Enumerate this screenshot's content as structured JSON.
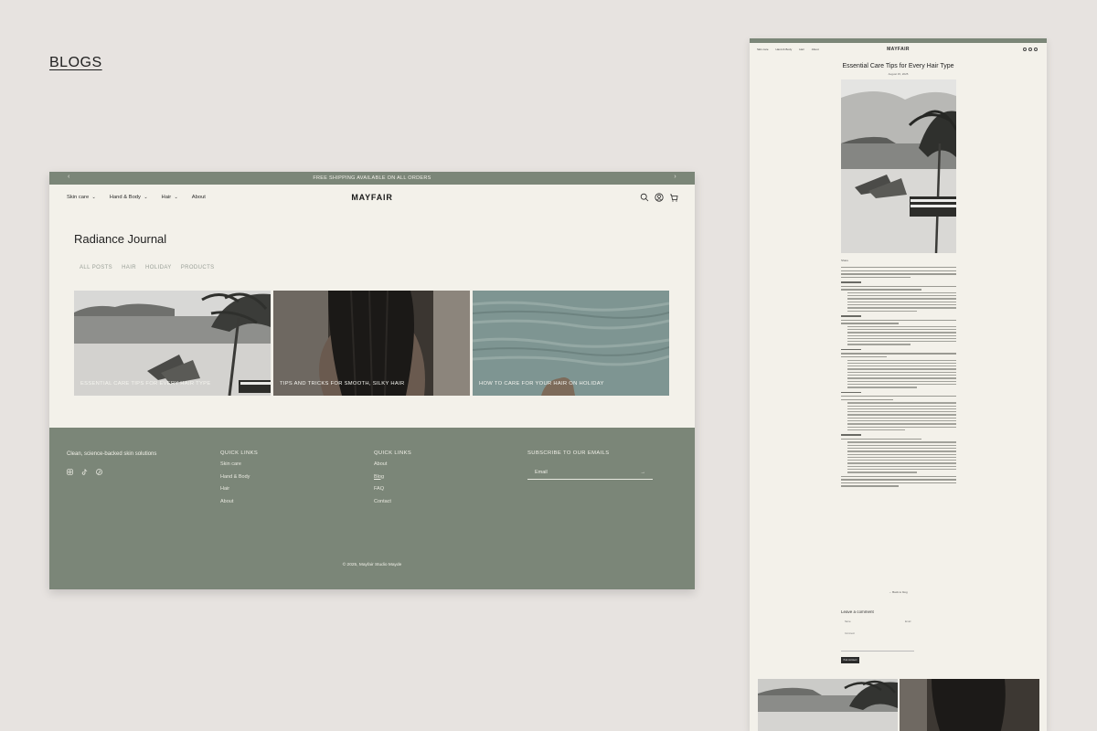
{
  "page": {
    "heading": "BLOGS"
  },
  "desktop": {
    "announcement": "FREE SHIPPING AVAILABLE ON ALL ORDERS",
    "nav": {
      "items": [
        "Skin care",
        "Hand & Body",
        "Hair",
        "About"
      ]
    },
    "logo": "MAYFAIR",
    "journal_title": "Radiance Journal",
    "filters": [
      "ALL POSTS",
      "HAIR",
      "HOLIDAY",
      "PRODUCTS"
    ],
    "cards": [
      {
        "label": "ESSENTIAL CARE TIPS FOR EVERY HAIR TYPE"
      },
      {
        "label": "TIPS AND TRICKS FOR SMOOTH, SILKY HAIR"
      },
      {
        "label": "HOW TO CARE FOR YOUR HAIR ON HOLIDAY"
      }
    ],
    "footer": {
      "tagline": "Clean, science-backed skin solutions",
      "col1": {
        "title": "QUICK LINKS",
        "links": [
          "Skin care",
          "Hand & Body",
          "Hair",
          "About"
        ]
      },
      "col2": {
        "title": "QUICK LINKS",
        "links": [
          "About",
          "Blog",
          "FAQ",
          "Contact"
        ]
      },
      "subscribe": {
        "title": "SUBSCRIBE TO OUR EMAILS",
        "placeholder": "Email"
      },
      "copyright": "© 2025, Mayfair Studio Mayde"
    }
  },
  "mobile": {
    "logo": "MAYFAIR",
    "nav": [
      "Skin care",
      "Hand & Body",
      "Hair",
      "About"
    ],
    "post_title": "Essential Care Tips for Every Hair Type",
    "post_date": "August 15, 2025",
    "share": "Share",
    "back_link": "← Back to blog",
    "comment_heading": "Leave a comment",
    "name_label": "Name",
    "email_label": "Email",
    "comment_label": "Comment",
    "post_button": "Post comment"
  },
  "colors": {
    "sage": "#7b8678",
    "cream": "#f3f1ea",
    "background": "#e7e3e0"
  }
}
